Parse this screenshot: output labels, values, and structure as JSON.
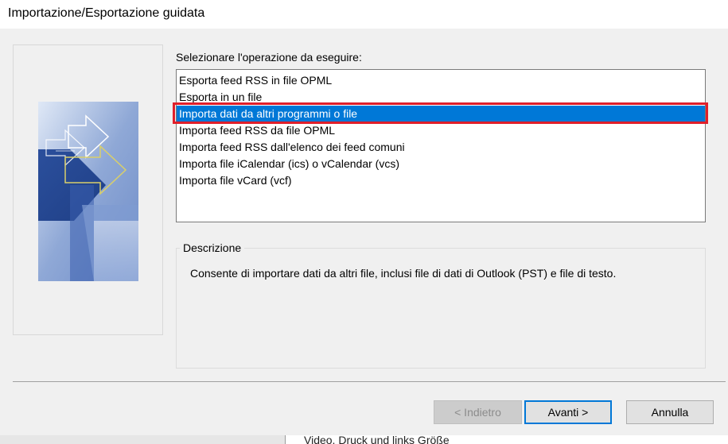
{
  "window": {
    "title": "Importazione/Esportazione guidata"
  },
  "list": {
    "label": "Selezionare l'operazione da eseguire:",
    "items": [
      {
        "label": "Esporta feed RSS in file OPML",
        "selected": false
      },
      {
        "label": "Esporta in un file",
        "selected": false
      },
      {
        "label": "Importa dati da altri programmi o file",
        "selected": true
      },
      {
        "label": "Importa feed RSS da file OPML",
        "selected": false
      },
      {
        "label": "Importa feed RSS dall'elenco dei feed comuni",
        "selected": false
      },
      {
        "label": "Importa file iCalendar (ics) o vCalendar (vcs)",
        "selected": false
      },
      {
        "label": "Importa file vCard (vcf)",
        "selected": false
      }
    ]
  },
  "description": {
    "title": "Descrizione",
    "text": "Consente di importare dati da altri file, inclusi file di dati di Outlook (PST) e file di testo."
  },
  "buttons": {
    "back": "< Indietro",
    "next": "Avanti >",
    "cancel": "Annulla"
  },
  "background_window": {
    "text": "Video, Druck und links Größe"
  },
  "colors": {
    "selection": "#0078d7",
    "highlight_border": "#e01f2a",
    "dialog_bg": "#f0f0f0"
  }
}
